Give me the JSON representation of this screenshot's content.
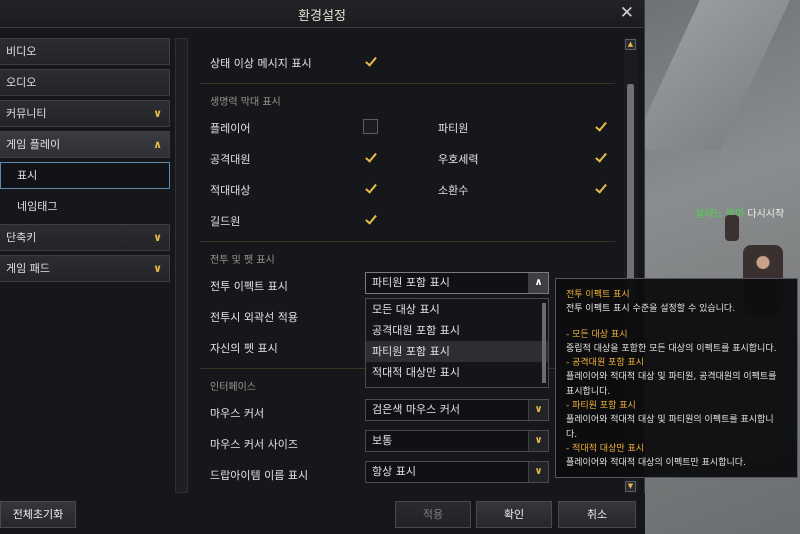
{
  "window": {
    "title": "환경설정"
  },
  "nav": {
    "items": [
      {
        "label": "비디오",
        "chevron": ""
      },
      {
        "label": "오디오",
        "chevron": ""
      },
      {
        "label": "커뮤니티",
        "chevron": "down"
      },
      {
        "label": "게임 플레이",
        "chevron": "up"
      }
    ],
    "subitems": [
      {
        "label": "표시",
        "selected": true
      },
      {
        "label": "네임태그",
        "selected": false
      }
    ],
    "items_after": [
      {
        "label": "단축키",
        "chevron": "down"
      },
      {
        "label": "게임 패드",
        "chevron": "down"
      }
    ]
  },
  "content": {
    "status_row": {
      "label": "상태 이상 메시지 표시",
      "checked": true
    },
    "section_hp": "생명력 막대 표시",
    "hp_rows": [
      {
        "left": "플레이어",
        "left_checked": false,
        "right": "파티원",
        "right_checked": true
      },
      {
        "left": "공격대원",
        "left_checked": true,
        "right": "우호세력",
        "right_checked": true
      },
      {
        "left": "적대대상",
        "left_checked": true,
        "right": "소환수",
        "right_checked": true
      },
      {
        "left": "길드원",
        "left_checked": true,
        "right": "",
        "right_checked": null
      }
    ],
    "section_combat": "전투 및 펫 표시",
    "combat_effect_label": "전투 이펙트 표시",
    "combat_effect_value": "파티원 포함 표시",
    "combat_outline_label": "전투시 외곽선 적용",
    "pet_label": "자신의 펫 표시",
    "dropdown_options": [
      "모든 대상 표시",
      "공격대원 포함 표시",
      "파티원 포함 표시",
      "적대적 대상만 표시"
    ],
    "section_interface": "인터페이스",
    "cursor_label": "마우스 커서",
    "cursor_value": "검은색 마우스 커서",
    "cursor_size_label": "마우스 커서 사이즈",
    "cursor_size_value": "보통",
    "drop_item_label": "드랍아이템 이름 표시",
    "drop_item_value": "항상 표시"
  },
  "tooltip": {
    "title": "전투 이펙트 표시",
    "desc": "전투 이펙트 표시 수준을 설정할 수 있습니다.",
    "opt1_title": "- 모든 대상 표시",
    "opt1_desc": "중립적 대상을 포함한 모든 대상의 이펙트를 표시합니다.",
    "opt2_title": "- 공격대원 포함 표시",
    "opt2_desc1": "플레이어와 적대적 대상 및 파티원, 공격대원의 이펙트를",
    "opt2_desc2": "표시합니다.",
    "opt3_title": "- 파티원 포함 표시",
    "opt3_desc1": "플레이어와 적대적 대상 및 파티원의 이펙트를 표시합니",
    "opt3_desc2": "다.",
    "opt4_title": "- 적대적 대상만 표시",
    "opt4_desc": "플레이어와 적대적 대상의 이펙트만 표시합니다."
  },
  "buttons": {
    "reset": "전체초기화",
    "apply": "적용",
    "ok": "확인",
    "cancel": "취소"
  },
  "world": {
    "npc_name_green": "실레느 악마",
    "npc_name_white": "다시시작"
  },
  "colors": {
    "accent": "#e8bd47",
    "tooltip_title": "#f0b23a",
    "selected_border": "#5b89b0"
  }
}
